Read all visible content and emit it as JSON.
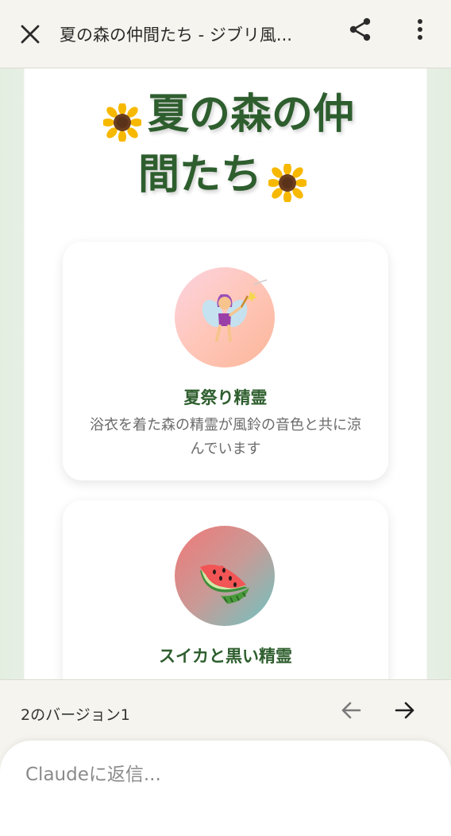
{
  "topbar": {
    "title": "夏の森の仲間たち - ジブリ風...",
    "close_icon": "close-icon",
    "share_icon": "share-icon",
    "more_icon": "more-vert-icon"
  },
  "page": {
    "heading_line1": "夏の森の仲",
    "heading_line2": "間たち",
    "heading_emoji": "sunflower-icon"
  },
  "cards": [
    {
      "title": "夏祭り精霊",
      "description": "浴衣を着た森の精霊が風鈴の音色と共に涼んでいます",
      "icon": "fairy-icon"
    },
    {
      "title": "スイカと黒い精霊",
      "description": "",
      "icon": "watermelon-icon"
    }
  ],
  "bottombar": {
    "version_label": "2のバージョン1",
    "reply_placeholder": "Claudeに返信..."
  },
  "colors": {
    "heading": "#2e5e2e",
    "topbar_bg": "#f5f4ee",
    "page_bg": "#e3eee0"
  }
}
